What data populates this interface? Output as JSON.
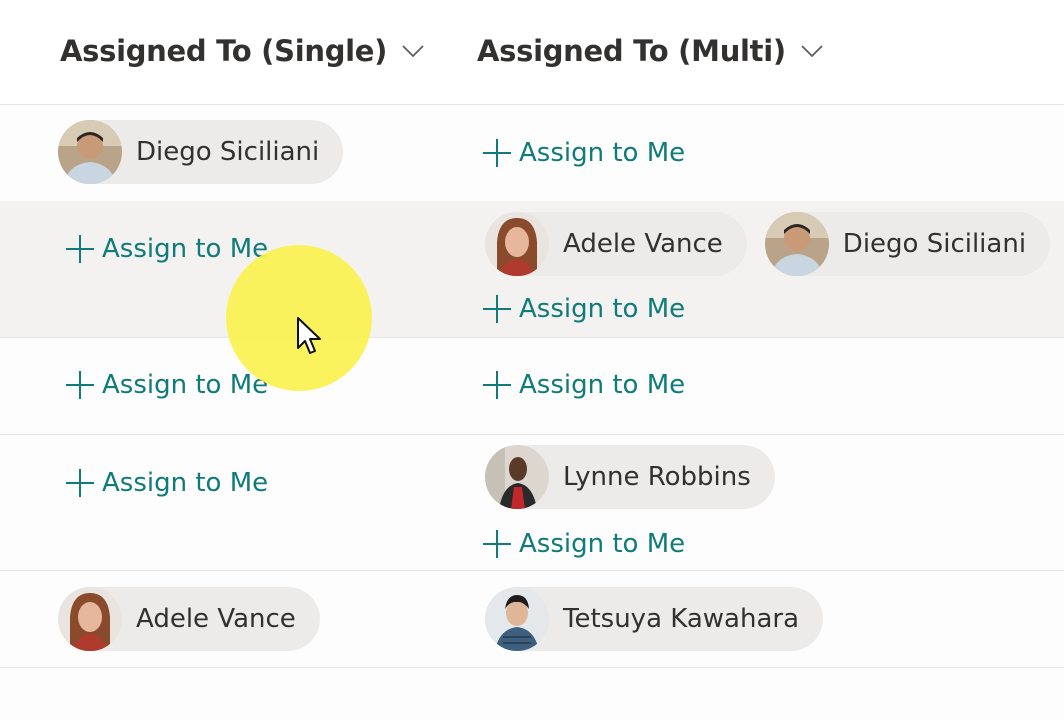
{
  "columns": {
    "single": {
      "label": "Assigned To (Single)",
      "icon": "chevron-down-icon"
    },
    "multi": {
      "label": "Assigned To (Multi)",
      "icon": "chevron-down-icon"
    }
  },
  "assign_label": "Assign to Me",
  "people": {
    "diego": "Diego Siciliani",
    "adele": "Adele Vance",
    "lynne": "Lynne Robbins",
    "tetsuya": "Tetsuya Kawahara"
  },
  "rows": [
    {
      "single": [
        "Diego Siciliani"
      ],
      "multi": [],
      "multi_assign": true
    },
    {
      "single": [],
      "single_assign": true,
      "multi": [
        "Adele Vance",
        "Diego Siciliani"
      ],
      "multi_assign": true,
      "highlighted": true
    },
    {
      "single": [],
      "single_assign": true,
      "multi": [],
      "multi_assign": true
    },
    {
      "single": [],
      "single_assign": true,
      "multi": [
        "Lynne Robbins"
      ],
      "multi_assign": true
    },
    {
      "single": [
        "Adele Vance"
      ],
      "multi": [
        "Tetsuya Kawahara"
      ]
    }
  ],
  "colors": {
    "accent": "#0f7b7a",
    "pill": "#edebe9",
    "row_highlight": "#f3f2f1",
    "pointer_highlight": "#fbf250"
  }
}
